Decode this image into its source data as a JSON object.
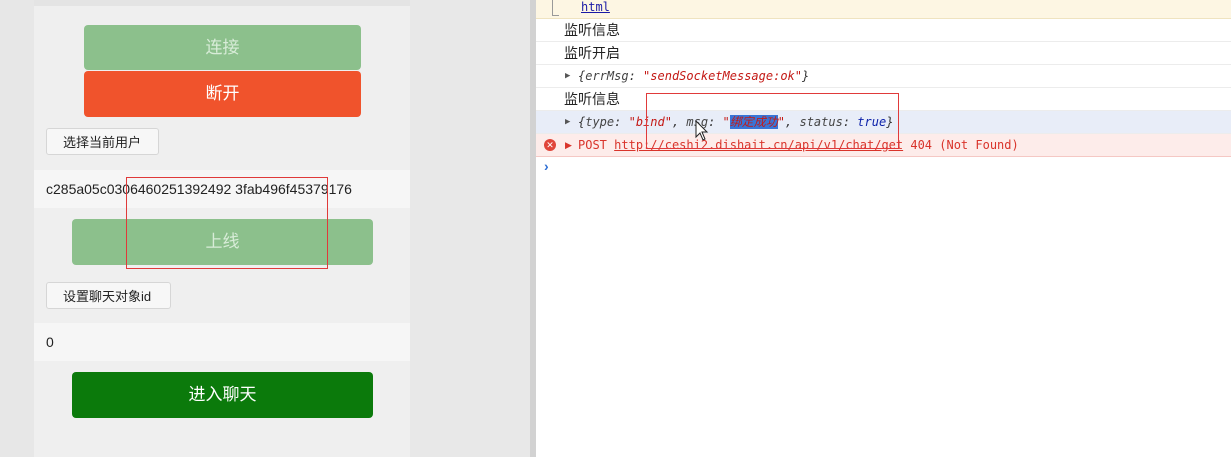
{
  "app": {
    "connect_label": "连接",
    "disconnect_label": "断开",
    "select_user_label": "选择当前用户",
    "current_user_id": "c285a05c0306460251392492 3fab496f45379176",
    "online_label": "上线",
    "set_target_label": "设置聊天对象id",
    "target_id": "0",
    "enter_chat_label": "进入聊天"
  },
  "console": {
    "html_link": "html",
    "lines": [
      "监听信息",
      "监听开启"
    ],
    "obj1": {
      "brace_open": "{",
      "key": "errMsg",
      "value": "\"sendSocketMessage:ok\"",
      "brace_close": "}"
    },
    "line3": "监听信息",
    "obj2": {
      "brace_open": "{",
      "type_key": "type",
      "type_value": "\"bind\"",
      "msg_key": "msg",
      "msg_quote_open": "\"",
      "msg_value": "绑定成功",
      "msg_quote_close": "\"",
      "status_key": "status",
      "status_value": "true",
      "brace_close": "}"
    },
    "error": {
      "method": "POST",
      "url": "http://ceshi2.dishait.cn/api/v1/chat/get",
      "status": "404 (Not Found)"
    },
    "prompt": "›"
  },
  "colors": {
    "connect_disabled": "#8cc08c",
    "disconnect": "#f0532c",
    "enter_chat": "#0b7a0b",
    "error": "#d9342b",
    "highlight": "#3875d7",
    "annotation_box": "#e03a3a"
  },
  "icons": {
    "error": "error-circle-icon",
    "expand": "triangle-right-icon",
    "pointer": "mouse-pointer-icon"
  }
}
